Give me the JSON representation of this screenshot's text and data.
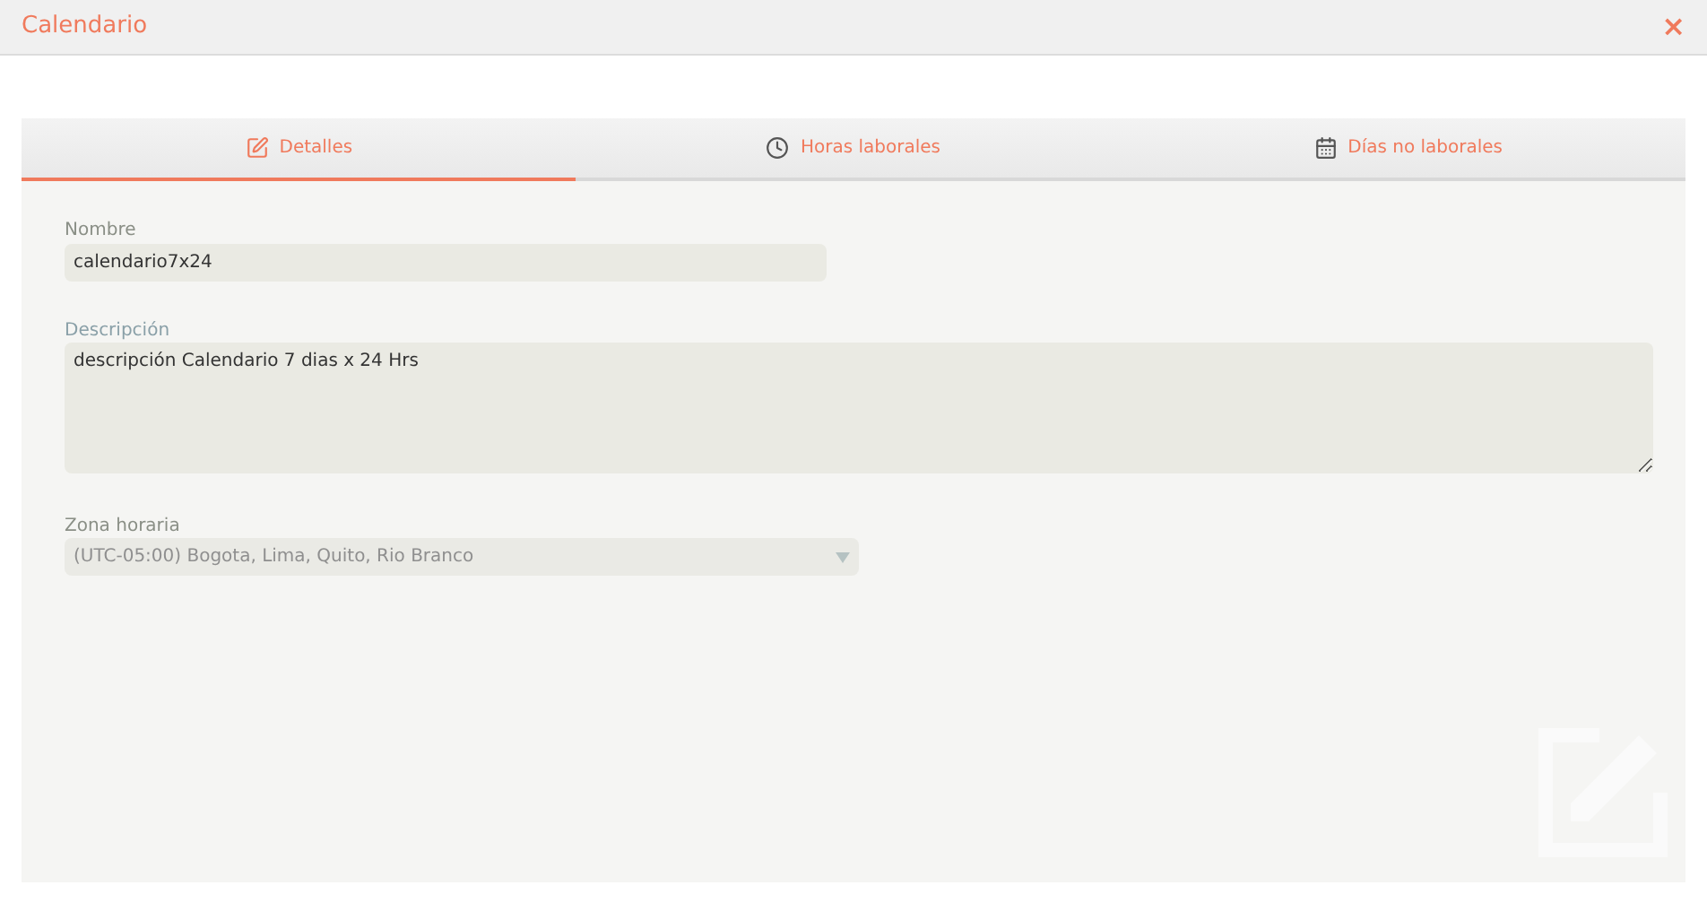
{
  "window": {
    "title": "Calendario",
    "close": "×"
  },
  "tabs": [
    {
      "label": "Detalles",
      "kind": "edit",
      "selected": true
    },
    {
      "label": "Horas laborales",
      "kind": "clock",
      "selected": false
    },
    {
      "label": "Días no laborales",
      "kind": "calendar",
      "selected": false
    }
  ],
  "form": {
    "name": {
      "label": "Nombre",
      "value": "calendario7x24"
    },
    "description": {
      "label": "Descripción",
      "value": "descripción Calendario 7 dias x 24 Hrs"
    },
    "timezone": {
      "label": "Zona horaria",
      "value": "(UTC-05:00) Bogota, Lima, Quito, Rio Branco",
      "disabled": true
    }
  }
}
